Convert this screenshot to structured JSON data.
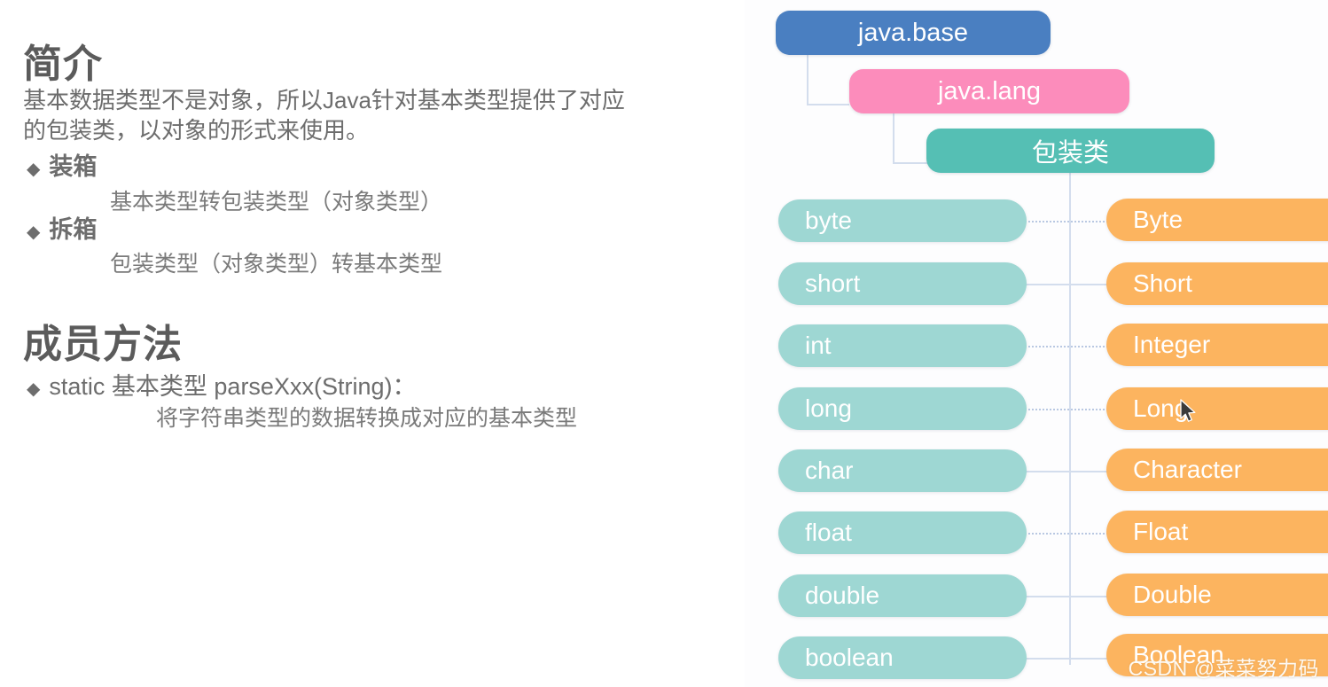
{
  "left_pane": {
    "sections": [
      {
        "heading": "简介",
        "paragraph_lines": [
          "基本数据类型不是对象，所以Java针对基本类型提供了对应",
          "的包装类，以对象的形式来使用。"
        ],
        "bullets": [
          {
            "marker": "◆",
            "label": "装箱",
            "bold": true,
            "detail": "基本类型转包装类型（对象类型）"
          },
          {
            "marker": "◆",
            "label": "拆箱",
            "bold": true,
            "detail": "包装类型（对象类型）转基本类型"
          }
        ]
      },
      {
        "heading": "成员方法",
        "bullets": [
          {
            "marker": "◆",
            "label": "static 基本类型 parseXxx(String)：",
            "bold": false,
            "detail": "将字符串类型的数据转换成对应的基本类型"
          }
        ]
      }
    ]
  },
  "diagram": {
    "hierarchy": [
      {
        "label": "java.base",
        "color": "#4a7fc1"
      },
      {
        "label": "java.lang",
        "color": "#fc8cbb"
      },
      {
        "label": "包装类",
        "color": "#55bfb4"
      }
    ],
    "primitive_color": "#9ed7d3",
    "wrapper_color": "#fcb45f",
    "connector_color": "#d3dded",
    "pairs": [
      {
        "primitive": "byte",
        "wrapper": "Byte"
      },
      {
        "primitive": "short",
        "wrapper": "Short"
      },
      {
        "primitive": "int",
        "wrapper": "Integer"
      },
      {
        "primitive": "long",
        "wrapper": "Long"
      },
      {
        "primitive": "char",
        "wrapper": "Character"
      },
      {
        "primitive": "float",
        "wrapper": "Float"
      },
      {
        "primitive": "double",
        "wrapper": "Double"
      },
      {
        "primitive": "boolean",
        "wrapper": "Boolean"
      }
    ]
  },
  "watermark": {
    "text": "CSDN @菜菜努力码"
  }
}
